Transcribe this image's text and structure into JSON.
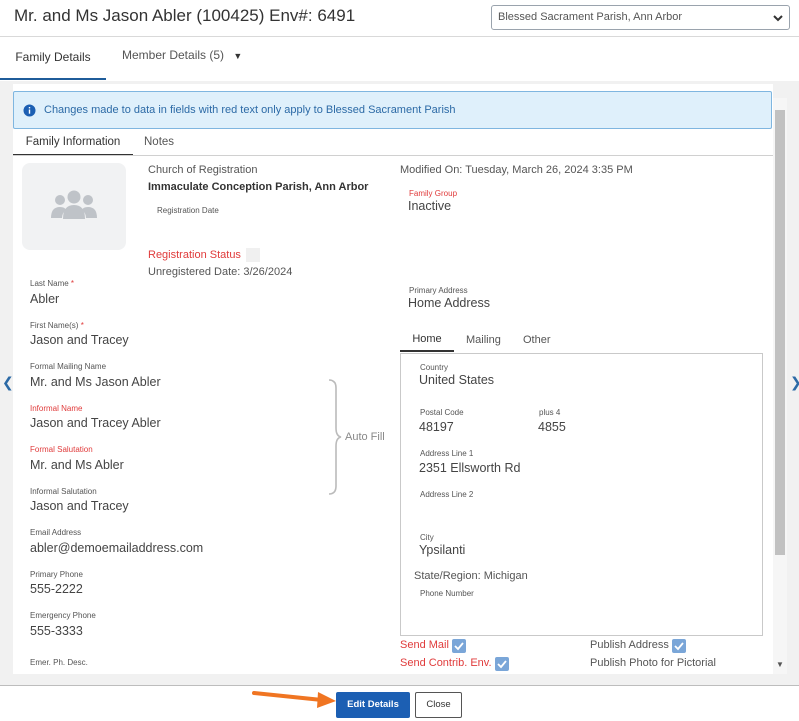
{
  "header": {
    "title": "Mr. and Ms Jason Abler (100425) Env#: 6491",
    "parish_select": "Blessed Sacrament Parish, Ann Arbor"
  },
  "tabs": {
    "family_details": "Family Details",
    "member_details": "Member Details (5)",
    "member_caret": "▼"
  },
  "info_banner": "Changes made to data in fields with red text only apply to Blessed Sacrament Parish",
  "subtabs": {
    "family_information": "Family Information",
    "notes": "Notes"
  },
  "church_of_registration": {
    "label": "Church of Registration",
    "value": "Immaculate Conception Parish, Ann Arbor"
  },
  "registration_date_label": "Registration Date",
  "registration_status_label": "Registration Status",
  "unregistered_date": "Unregistered Date: 3/26/2024",
  "modified_on": "Modified On: Tuesday, March 26, 2024 3:35 PM",
  "family_group": {
    "label": "Family Group",
    "value": "Inactive"
  },
  "primary_address": {
    "label": "Primary Address",
    "value": "Home Address"
  },
  "fields": {
    "last_name": {
      "label": "Last Name",
      "required": "*",
      "value": "Abler"
    },
    "first_names": {
      "label": "First Name(s)",
      "required": "*",
      "value": "Jason and Tracey"
    },
    "formal_mailing_name": {
      "label": "Formal Mailing Name",
      "value": "Mr. and Ms Jason Abler"
    },
    "informal_name": {
      "label": "Informal Name",
      "value": "Jason and Tracey Abler"
    },
    "formal_salutation": {
      "label": "Formal Salutation",
      "value": "Mr. and Ms Abler"
    },
    "informal_salutation": {
      "label": "Informal Salutation",
      "value": "Jason and Tracey"
    },
    "email": {
      "label": "Email Address",
      "value": "abler@demoemailaddress.com"
    },
    "primary_phone": {
      "label": "Primary Phone",
      "value": "555-2222"
    },
    "emergency_phone": {
      "label": "Emergency Phone",
      "value": "555-3333"
    },
    "emer_ph_desc": {
      "label": "Emer. Ph. Desc."
    }
  },
  "auto_fill": "Auto Fill",
  "address_tabs": {
    "home": "Home",
    "mailing": "Mailing",
    "other": "Other"
  },
  "address": {
    "country_label": "Country",
    "country": "United States",
    "postal_label": "Postal Code",
    "postal": "48197",
    "plus4_label": "plus 4",
    "plus4": "4855",
    "line1_label": "Address Line 1",
    "line1": "2351 Ellsworth Rd",
    "line2_label": "Address Line 2",
    "city_label": "City",
    "city": "Ypsilanti",
    "state": "State/Region: Michigan",
    "phone_label": "Phone Number"
  },
  "checkboxes": {
    "send_mail": "Send Mail",
    "send_contrib_env": "Send Contrib. Env.",
    "publish_address": "Publish Address",
    "publish_photo": "Publish Photo for Pictorial"
  },
  "footer": {
    "edit_details": "Edit Details",
    "close": "Close"
  },
  "colors": {
    "accent": "#1c5fb3",
    "required_red": "#e03b3b",
    "banner_bg": "#dff0fb",
    "arrow": "#f07522"
  }
}
